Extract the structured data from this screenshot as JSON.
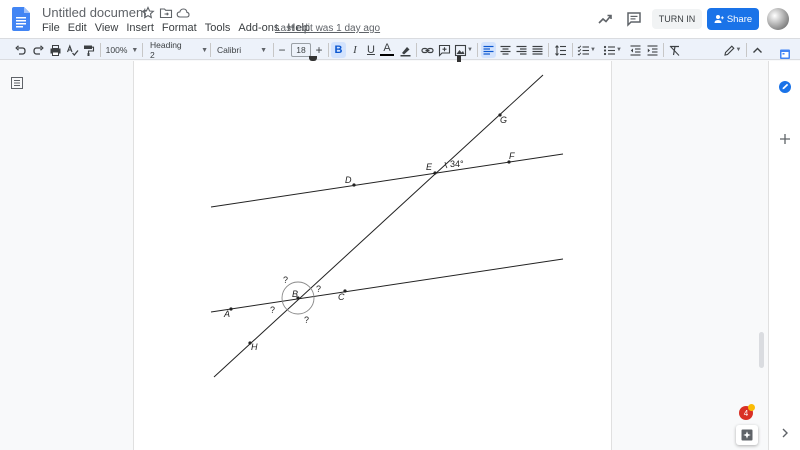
{
  "titlebar": {
    "doc_title": "Untitled document",
    "menu": [
      "File",
      "Edit",
      "View",
      "Insert",
      "Format",
      "Tools",
      "Add-ons",
      "Help"
    ],
    "last_edit": "Last edit was 1 day ago",
    "turn_in": "TURN IN",
    "share": "Share"
  },
  "toolbar": {
    "zoom": "100%",
    "style": "Heading 2",
    "font": "Calibri",
    "font_size": "18",
    "bold": "B",
    "italic": "I",
    "underline": "U",
    "text_color": "A"
  },
  "figure": {
    "points": {
      "A": "A",
      "B": "B",
      "C": "C",
      "D": "D",
      "E": "E",
      "F": "F",
      "G": "G",
      "H": "H"
    },
    "angle_known": "34°",
    "unknown": "?"
  },
  "notifications": {
    "count": "4"
  },
  "colors": {
    "accent": "#1a73e8",
    "toolbar_bg": "#edf2fa",
    "badge": "#d93025"
  }
}
